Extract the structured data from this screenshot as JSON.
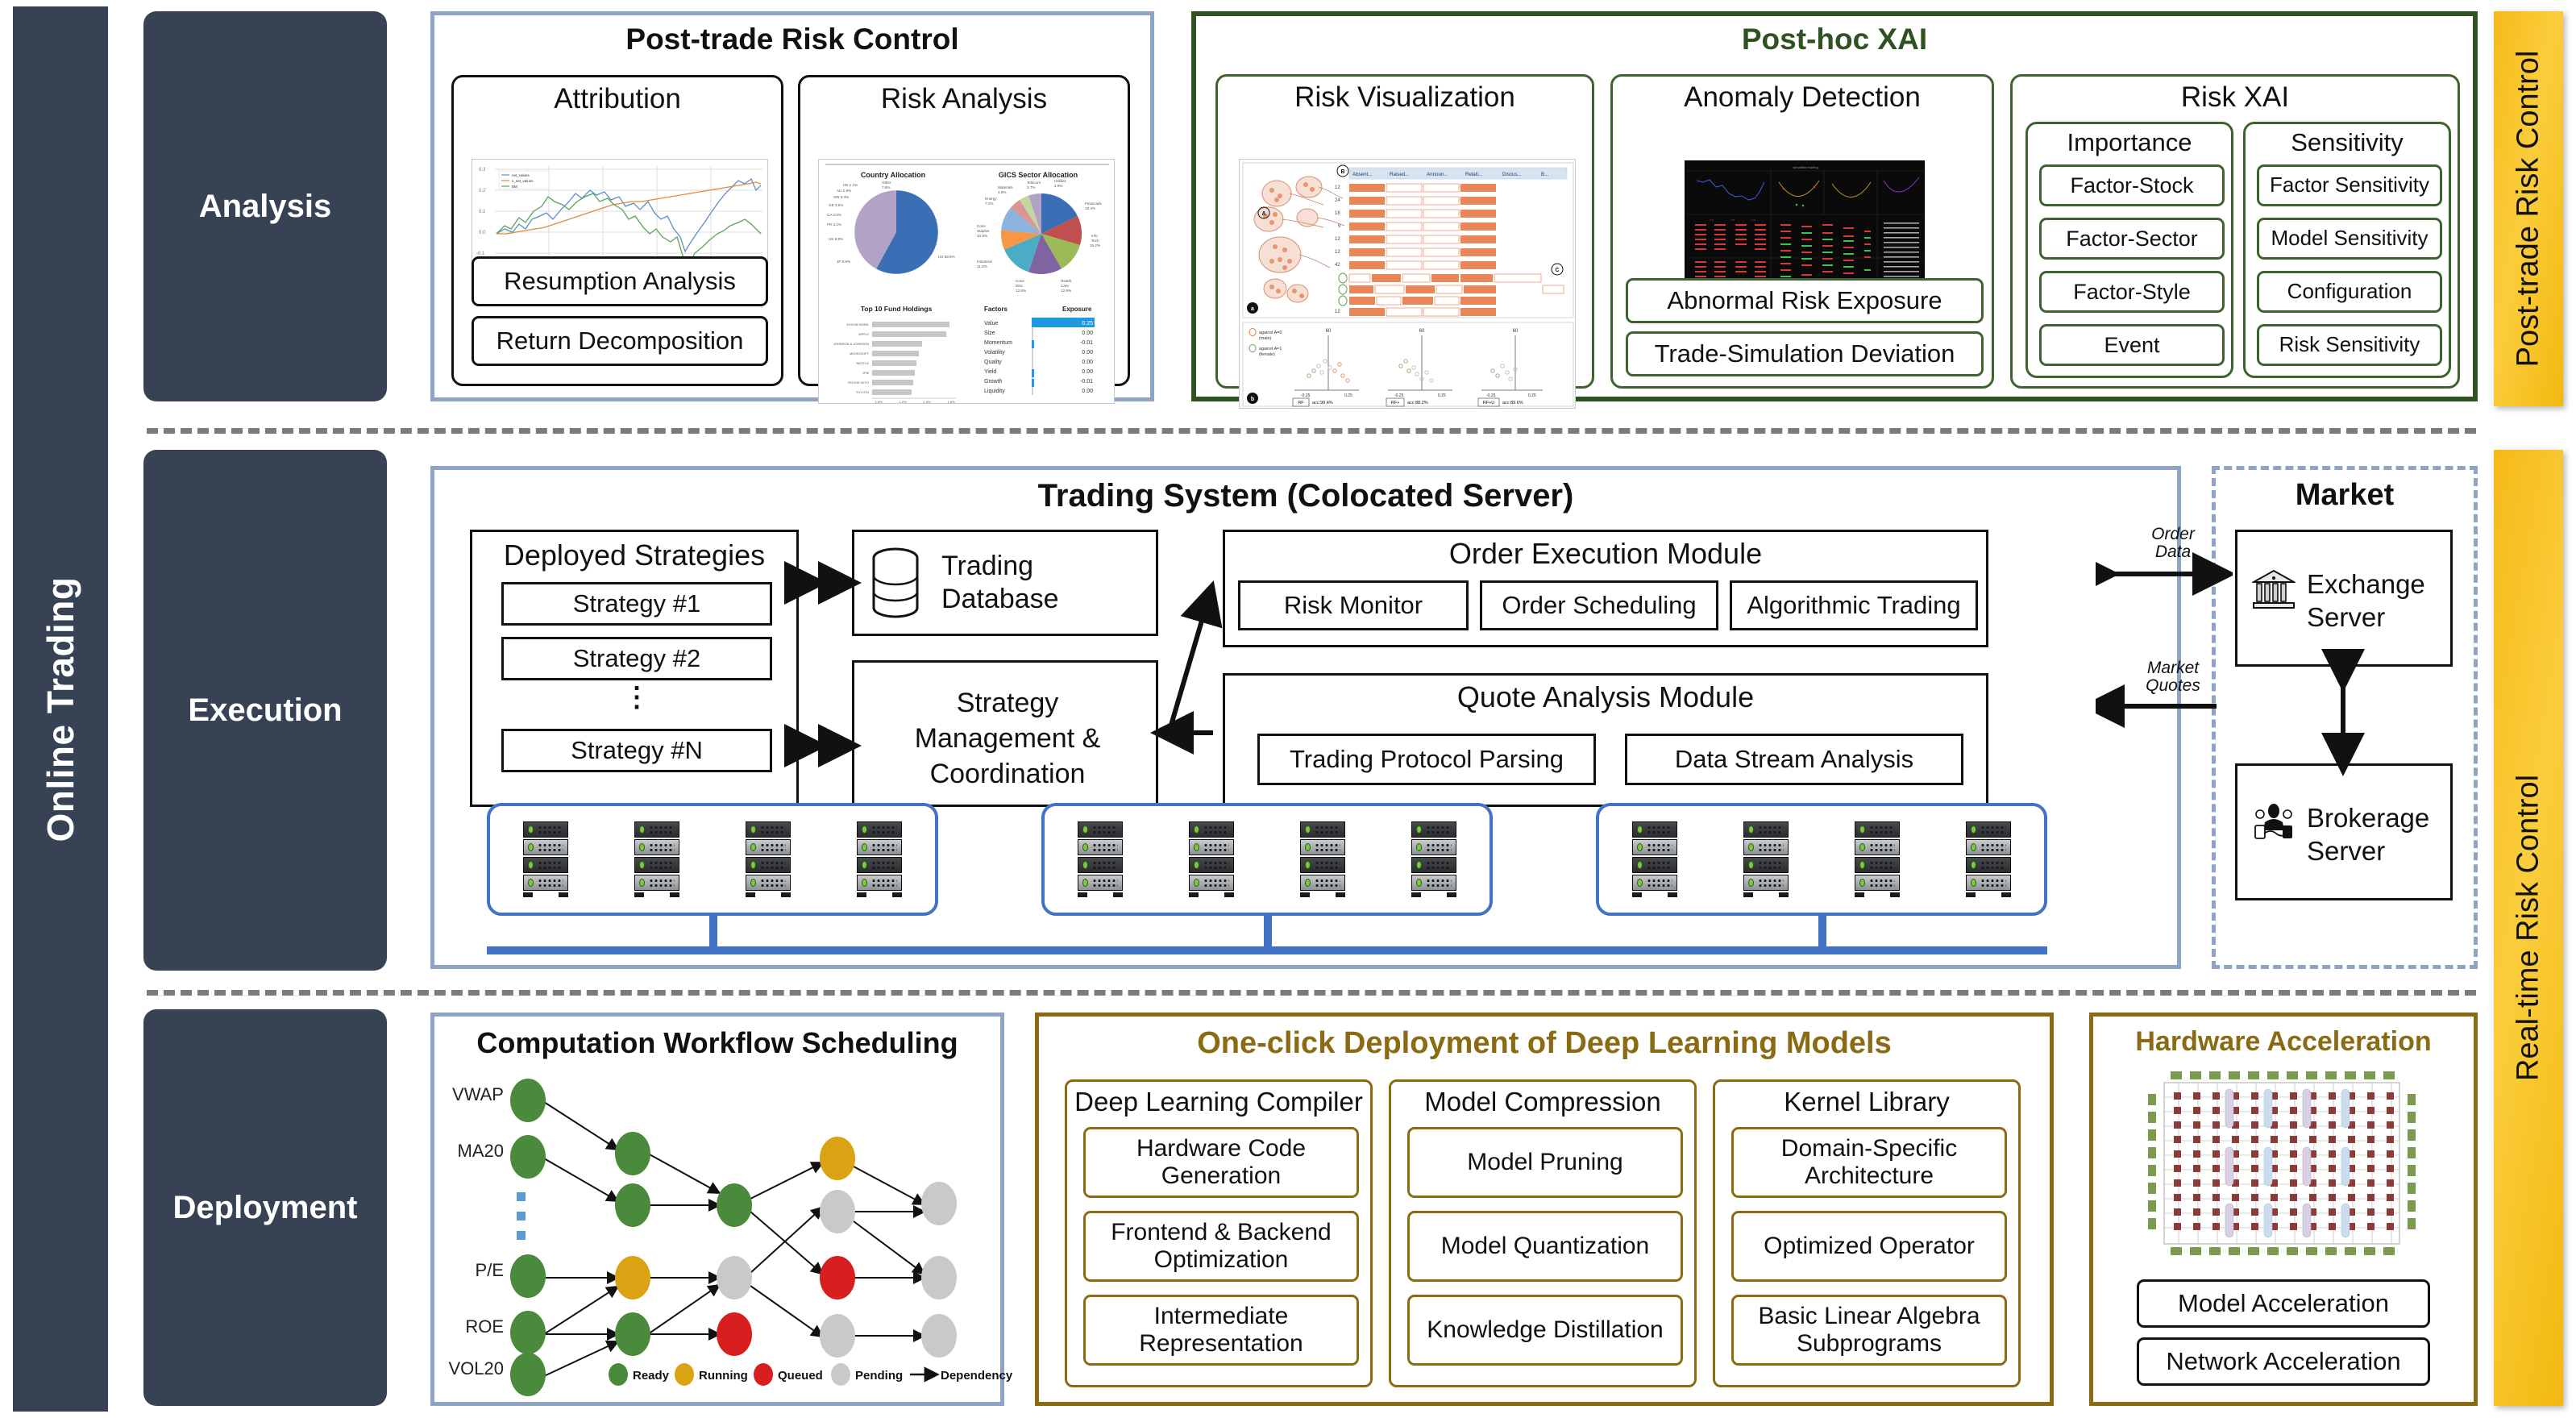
{
  "left_rail": {
    "label": "Online Trading"
  },
  "stages": [
    {
      "label": "Analysis"
    },
    {
      "label": "Execution"
    },
    {
      "label": "Deployment"
    }
  ],
  "right_bars": [
    {
      "label": "Post-trade Risk Control"
    },
    {
      "label": "Real-time Risk Control"
    }
  ],
  "row_analysis": {
    "post_trade": {
      "title": "Post-trade Risk Control",
      "cards": [
        {
          "title": "Attribution",
          "leaves": [
            "Resumption Analysis",
            "Return Decomposition"
          ]
        },
        {
          "title": "Risk Analysis",
          "leaves": []
        }
      ]
    },
    "post_hoc": {
      "title": "Post-hoc XAI",
      "cards": [
        {
          "title": "Risk Visualization",
          "leaves": []
        },
        {
          "title": "Anomaly Detection",
          "leaves": [
            "Abnormal Risk Exposure",
            "Trade-Simulation Deviation"
          ]
        },
        {
          "title": "Risk XAI",
          "subgroups": [
            {
              "title": "Importance",
              "leaves": [
                "Factor-Stock",
                "Factor-Sector",
                "Factor-Style",
                "Event"
              ]
            },
            {
              "title": "Sensitivity",
              "leaves": [
                "Factor Sensitivity",
                "Model Sensitivity",
                "Configuration",
                "Risk Sensitivity"
              ]
            }
          ]
        }
      ]
    }
  },
  "row_execution": {
    "trading_system": {
      "title": "Trading System (Colocated Server)",
      "deployed_strategies": {
        "title": "Deployed Strategies",
        "items": [
          "Strategy #1",
          "Strategy #2",
          "Strategy #N"
        ],
        "ellipsis": "⋮"
      },
      "trading_database": {
        "label": "Trading\nDatabase",
        "line1": "Trading",
        "line2": "Database"
      },
      "strategy_mgmt": {
        "line1": "Strategy",
        "line2": "Management &",
        "line3": "Coordination"
      },
      "order_execution": {
        "title": "Order Execution Module",
        "leaves": [
          "Risk Monitor",
          "Order Scheduling",
          "Algorithmic Trading"
        ]
      },
      "quote_analysis": {
        "title": "Quote Analysis Module",
        "leaves": [
          "Trading Protocol Parsing",
          "Data Stream Analysis"
        ]
      }
    },
    "edges": [
      {
        "line1": "Order",
        "line2": "Data"
      },
      {
        "line1": "Market",
        "line2": "Quotes"
      }
    ],
    "market": {
      "title": "Market",
      "nodes": [
        {
          "icon": "bank-icon",
          "line1": "Exchange",
          "line2": "Server"
        },
        {
          "icon": "handshake-icon",
          "line1": "Brokerage",
          "line2": "Server"
        }
      ]
    }
  },
  "row_deployment": {
    "workflow": {
      "title": "Computation Workflow Scheduling",
      "row_labels": [
        "VWAP",
        "MA20",
        "P/E",
        "ROE",
        "VOL20"
      ],
      "legend": [
        {
          "label": "Ready",
          "color": "#4a8a3c"
        },
        {
          "label": "Running",
          "color": "#d9a313"
        },
        {
          "label": "Queued",
          "color": "#d81f1f"
        },
        {
          "label": "Pending",
          "color": "#c9c9c9"
        },
        {
          "label": "Dependency",
          "color": "#111111"
        }
      ]
    },
    "oneclick": {
      "title": "One-click Deployment of Deep Learning Models",
      "columns": [
        {
          "title": "Deep Learning Compiler",
          "leaves": [
            "Hardware Code\nGeneration",
            "Frontend & Backend\nOptimization",
            "Intermediate\nRepresentation"
          ]
        },
        {
          "title": "Model Compression",
          "leaves": [
            "Model Pruning",
            "Model Quantization",
            "Knowledge Distillation"
          ]
        },
        {
          "title": "Kernel Library",
          "leaves": [
            "Domain-Specific\nArchitecture",
            "Optimized Operator",
            "Basic Linear Algebra\nSubprograms"
          ]
        }
      ]
    },
    "hardware": {
      "title": "Hardware Acceleration",
      "leaves": [
        "Model Acceleration",
        "Network Acceleration"
      ]
    }
  },
  "chart_data": [
    {
      "type": "line",
      "title": "Attribution",
      "xlabel": "",
      "ylabel": "",
      "ylim": [
        -0.2,
        0.3
      ],
      "yticks": [
        -0.2,
        -0.1,
        0.0,
        0.1,
        0.2,
        0.3
      ],
      "grid": true,
      "legend_position": "top-left",
      "series": [
        {
          "name": "net_values",
          "color": "#5b8fc9"
        },
        {
          "name": "s_net_values",
          "color": "#e08b3e"
        },
        {
          "name": "BM",
          "color": "#5aa45a"
        }
      ]
    },
    {
      "type": "pie",
      "title": "Country Allocation",
      "categories": [
        "US",
        "JP",
        "UK",
        "FR",
        "CA",
        "GE",
        "SW",
        "AU",
        "HK",
        "Other"
      ],
      "values": [
        58.6,
        8.9,
        6.8,
        3.1,
        3.0,
        3.0,
        3.4,
        2.9,
        1.1,
        7.8
      ],
      "labels": [
        "US 58.6%",
        "JP 8.9%",
        "UK 6.8%",
        "FR 3.1%",
        "CA 3.0%",
        "GE 3.0%",
        "SW 3.4%",
        "AU 2.9%",
        "HK 1.1%",
        "Other 7.8%"
      ],
      "colors": [
        "#3b6fb5",
        "#c0504d",
        "#9bbb59",
        "#8064a2",
        "#4bacc6",
        "#f79646",
        "#6f95d2",
        "#d99694",
        "#c3d69b",
        "#b3a2c7"
      ]
    },
    {
      "type": "pie",
      "title": "GICS Sector Allocation",
      "categories": [
        "Financials",
        "Info Tech",
        "Health Care",
        "Cons Disc",
        "Industrial",
        "Cons Staples",
        "Energy",
        "Materials",
        "Telecom",
        "Utilities"
      ],
      "values": [
        19.3,
        15.2,
        12.9,
        12.8,
        11.2,
        10.9,
        7.2,
        4.8,
        3.7,
        2.9
      ],
      "labels": [
        "Financials 19.3%",
        "Info Tech 15.2%",
        "Health Care 12.9%",
        "Cons Disc 12.8%",
        "Industrial 11.2%",
        "Cons Staples 10.9%",
        "Energy 7.2%",
        "Materials 4.8%",
        "Telecom 3.7%",
        "Utilities 2.9%"
      ],
      "colors": [
        "#3b6fb5",
        "#c0504d",
        "#9bbb59",
        "#8064a2",
        "#4bacc6",
        "#f79646",
        "#8ab4dd",
        "#d99694",
        "#c3d69b",
        "#b3a2c7"
      ]
    },
    {
      "type": "bar",
      "title": "Top 10 Fund Holdings",
      "orientation": "horizontal",
      "categories": [
        "EXXON MOBIL",
        "APPLE",
        "JOHNSON & JOHNSON",
        "MICROSOFT",
        "NESTLE",
        "JPM",
        "ROCHE HLTG",
        "TOYOTA",
        "AT&T",
        "GE"
      ],
      "values": [
        1.57,
        1.53,
        1.32,
        1.29,
        1.27,
        1.25,
        1.24,
        1.22,
        1.21,
        1.19
      ],
      "xticks": [
        "1.0%",
        "1.2%",
        "1.4%",
        "1.6%"
      ],
      "xlim": [
        1.0,
        1.6
      ],
      "bar_color": "#c6c6c6"
    },
    {
      "type": "table",
      "title": "Factor Exposure",
      "columns": [
        "Factors",
        "Exposure"
      ],
      "rows": [
        [
          "Value",
          "0.25"
        ],
        [
          "Size",
          "0.00"
        ],
        [
          "Momentum",
          "-0.01"
        ],
        [
          "Volatility",
          "0.00"
        ],
        [
          "Quality",
          "0.00"
        ],
        [
          "Yield",
          "0.00"
        ],
        [
          "Growth",
          "-0.01"
        ],
        [
          "Liquidity",
          "0.00"
        ]
      ],
      "highlight_row": 0,
      "highlight_color": "#1f9ae0"
    },
    {
      "type": "scatter",
      "title": "Risk Visualization",
      "legend": [
        "against A=0 (male)",
        "against A=1 (female)"
      ],
      "panels": [
        {
          "name": "RF",
          "accuracy": "acc:90.4%",
          "xticks": [
            "-0.25",
            "0.25"
          ],
          "top": "60"
        },
        {
          "name": "RF+",
          "accuracy": "acc:88.2%",
          "xticks": [
            "-0.25",
            "0.25"
          ],
          "top": "60"
        },
        {
          "name": "RF+U",
          "accuracy": "acc:89.6%",
          "xticks": [
            "-0.25",
            "0.25"
          ],
          "top": "60"
        }
      ],
      "table_headers": [
        "Absent...",
        "Raised...",
        "Announ...",
        "Relati...",
        "Discus...",
        "B..."
      ],
      "row_counts": [
        "12",
        "24",
        "18",
        "9",
        "12",
        "12",
        "42",
        "12"
      ],
      "markers": [
        "a",
        "b",
        "A",
        "B",
        "C"
      ]
    },
    {
      "type": "heatmap",
      "title": "Anomaly Detection Dashboard",
      "panels": 4,
      "note": "dark trading terminal with line/curve charts and red-green quote tables"
    },
    {
      "type": "scatter",
      "title": "Computation Workflow Scheduling DAG",
      "node_states": [
        "Ready",
        "Running",
        "Queued",
        "Pending"
      ],
      "state_colors": [
        "#4a8a3c",
        "#d9a313",
        "#d81f1f",
        "#c9c9c9"
      ],
      "x_levels": 5,
      "nodes": [
        {
          "x": 0,
          "y": 0,
          "state": "Ready"
        },
        {
          "x": 0,
          "y": 1,
          "state": "Ready"
        },
        {
          "x": 0,
          "y": 3,
          "state": "Ready"
        },
        {
          "x": 0,
          "y": 4,
          "state": "Ready"
        },
        {
          "x": 0,
          "y": 5,
          "state": "Ready"
        },
        {
          "x": 1,
          "y": 1,
          "state": "Ready"
        },
        {
          "x": 1,
          "y": 2,
          "state": "Ready"
        },
        {
          "x": 1,
          "y": 3,
          "state": "Running"
        },
        {
          "x": 1,
          "y": 4,
          "state": "Ready"
        },
        {
          "x": 2,
          "y": 2,
          "state": "Ready"
        },
        {
          "x": 2,
          "y": 3,
          "state": "Pending"
        },
        {
          "x": 2,
          "y": 4,
          "state": "Queued"
        },
        {
          "x": 3,
          "y": 1,
          "state": "Running"
        },
        {
          "x": 3,
          "y": 2,
          "state": "Pending"
        },
        {
          "x": 3,
          "y": 3,
          "state": "Queued"
        },
        {
          "x": 3,
          "y": 4,
          "state": "Pending"
        },
        {
          "x": 4,
          "y": 2,
          "state": "Pending"
        },
        {
          "x": 4,
          "y": 3,
          "state": "Pending"
        },
        {
          "x": 4,
          "y": 4,
          "state": "Pending"
        }
      ]
    }
  ]
}
